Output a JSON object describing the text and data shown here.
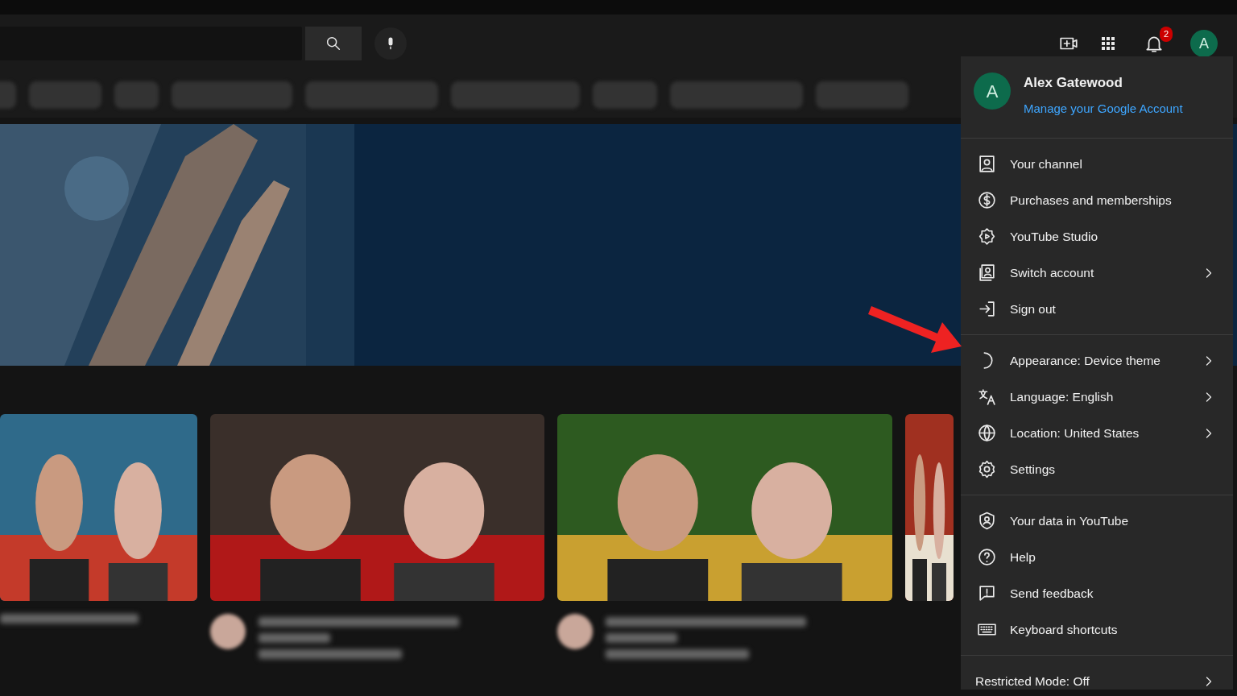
{
  "header": {
    "notification_count": "2",
    "avatar_letter": "A"
  },
  "account_menu": {
    "avatar_letter": "A",
    "name": "Alex Gatewood",
    "manage_link": "Manage your Google Account",
    "sections": [
      [
        {
          "label": "Your channel",
          "submenu": false
        },
        {
          "label": "Purchases and memberships",
          "submenu": false
        },
        {
          "label": "YouTube Studio",
          "submenu": false
        },
        {
          "label": "Switch account",
          "submenu": true
        },
        {
          "label": "Sign out",
          "submenu": false
        }
      ],
      [
        {
          "label": "Appearance: Device theme",
          "submenu": true
        },
        {
          "label": "Language: English",
          "submenu": true
        },
        {
          "label": "Location: United States",
          "submenu": true
        },
        {
          "label": "Settings",
          "submenu": false
        }
      ],
      [
        {
          "label": "Your data in YouTube",
          "submenu": false
        },
        {
          "label": "Help",
          "submenu": false
        },
        {
          "label": "Send feedback",
          "submenu": false
        },
        {
          "label": "Keyboard shortcuts",
          "submenu": false
        }
      ]
    ],
    "footer": {
      "label": "Restricted Mode: Off",
      "submenu": true
    }
  }
}
